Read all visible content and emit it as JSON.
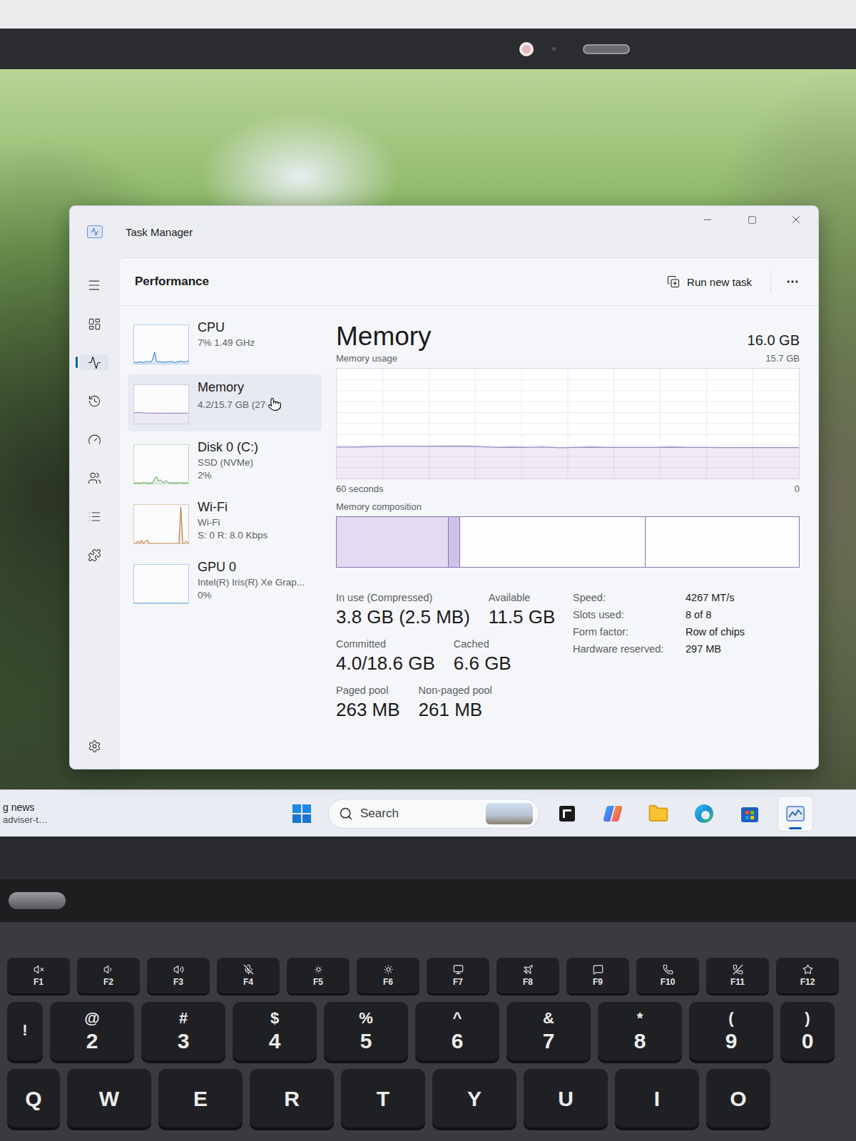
{
  "window": {
    "title": "Task Manager"
  },
  "nav": [
    {
      "selected": false
    },
    {
      "selected": true
    },
    {
      "selected": false
    },
    {
      "selected": false
    },
    {
      "selected": false
    },
    {
      "selected": false
    },
    {
      "selected": false
    }
  ],
  "header": {
    "title": "Performance",
    "action": "Run new task"
  },
  "resources": [
    {
      "name": "CPU",
      "lines": [
        "7% 1.49 GHz"
      ],
      "selected": false,
      "color": "#1a73c9",
      "values": [
        3,
        4,
        3,
        5,
        4,
        3,
        4,
        6,
        5,
        4,
        12,
        30,
        6,
        4,
        5,
        4,
        3,
        5,
        4,
        6,
        5,
        4,
        3,
        4,
        5,
        7,
        5,
        4,
        6,
        7
      ]
    },
    {
      "name": "Memory",
      "lines": [
        "4.2/15.7 GB (27"
      ],
      "selected": true,
      "color": "#8e6cbf",
      "values": [
        28,
        28,
        29,
        29,
        28,
        28,
        27,
        27,
        28,
        27,
        27,
        27,
        27,
        27,
        27,
        27,
        27,
        27,
        27,
        27,
        27,
        27,
        27,
        27,
        27,
        27,
        27,
        27,
        27,
        27
      ]
    },
    {
      "name": "Disk 0 (C:)",
      "lines": [
        "SSD (NVMe)",
        "2%"
      ],
      "selected": false,
      "color": "#4e9a3a",
      "values": [
        1,
        1,
        2,
        1,
        1,
        3,
        2,
        1,
        1,
        1,
        2,
        12,
        18,
        6,
        10,
        4,
        2,
        8,
        3,
        2,
        1,
        2,
        1,
        1,
        2,
        3,
        1,
        1,
        2,
        2
      ]
    },
    {
      "name": "Wi-Fi",
      "lines": [
        "Wi-Fi",
        "S: 0 R: 8.0 Kbps"
      ],
      "selected": false,
      "color": "#b5651d",
      "values": [
        0,
        0,
        6,
        0,
        8,
        0,
        5,
        9,
        0,
        0,
        0,
        0,
        0,
        0,
        0,
        0,
        0,
        0,
        0,
        0,
        0,
        0,
        0,
        0,
        0,
        95,
        0,
        0,
        6,
        0
      ]
    },
    {
      "name": "GPU 0",
      "lines": [
        "Intel(R) Iris(R) Xe Grap...",
        "0%"
      ],
      "selected": false,
      "color": "#1a73c9",
      "values": [
        0,
        0,
        0,
        0,
        0,
        0,
        0,
        0,
        0,
        0,
        0,
        0,
        0,
        0,
        0,
        0,
        0,
        0,
        0,
        0,
        0,
        0,
        0,
        0,
        0,
        0,
        0,
        0,
        0,
        0
      ]
    }
  ],
  "detail": {
    "title": "Memory",
    "total": "16.0 GB",
    "chart_label": "Memory usage",
    "axis_max": "15.7 GB",
    "axis_time": "60 seconds",
    "axis_min": "0",
    "values": [
      4.5,
      4.5,
      4.55,
      4.6,
      4.6,
      4.6,
      4.6,
      4.62,
      4.62,
      4.55,
      4.45,
      4.48,
      4.45,
      4.5,
      4.4,
      4.45,
      4.48,
      4.45,
      4.45,
      4.45,
      4.45,
      4.48,
      4.45,
      4.45,
      4.42,
      4.42,
      4.42,
      4.42,
      4.42,
      4.42
    ],
    "composition_label": "Memory composition",
    "composition": [
      {
        "kind": "in-use",
        "level": 0.24
      },
      {
        "kind": "modified",
        "level": 0.026
      },
      {
        "kind": "standby",
        "level": 0.4
      },
      {
        "kind": "free",
        "level": 0.334
      }
    ],
    "stats": [
      {
        "label": "In use (Compressed)",
        "value": "3.8 GB (2.5 MB)"
      },
      {
        "label": "Available",
        "value": "11.5 GB"
      },
      {
        "label": "Committed",
        "value": "4.0/18.6 GB"
      },
      {
        "label": "Cached",
        "value": "6.6 GB"
      },
      {
        "label": "Paged pool",
        "value": "263 MB"
      },
      {
        "label": "Non-paged pool",
        "value": "261 MB"
      }
    ],
    "specs": [
      {
        "label": "Speed:",
        "value": "4267 MT/s"
      },
      {
        "label": "Slots used:",
        "value": "8 of 8"
      },
      {
        "label": "Form factor:",
        "value": "Row of chips"
      },
      {
        "label": "Hardware reserved:",
        "value": "297 MB"
      }
    ]
  },
  "taskbar": {
    "widget": [
      "g news",
      "adviser-t…"
    ],
    "search": "Search",
    "apps": [
      {
        "selected": false
      },
      {
        "selected": false
      },
      {
        "selected": false
      },
      {
        "selected": false
      },
      {
        "selected": false
      },
      {
        "selected": true
      }
    ]
  },
  "keyboard": {
    "function_keys": [
      "F1",
      "F2",
      "F3",
      "F4",
      "F5",
      "F6",
      "F7",
      "F8",
      "F9",
      "F10",
      "F11",
      "F12"
    ],
    "number_keys": [
      {
        "top": "!",
        "main": ""
      },
      {
        "top": "@",
        "main": "2"
      },
      {
        "top": "#",
        "main": "3"
      },
      {
        "top": "$",
        "main": "4"
      },
      {
        "top": "%",
        "main": "5"
      },
      {
        "top": "^",
        "main": "6"
      },
      {
        "top": "&",
        "main": "7"
      },
      {
        "top": "*",
        "main": "8"
      },
      {
        "top": "(",
        "main": "9"
      },
      {
        "top": ")",
        "main": "0"
      }
    ],
    "letter_keys": [
      "Q",
      "W",
      "E",
      "R",
      "T",
      "Y",
      "U",
      "I",
      "O"
    ]
  }
}
